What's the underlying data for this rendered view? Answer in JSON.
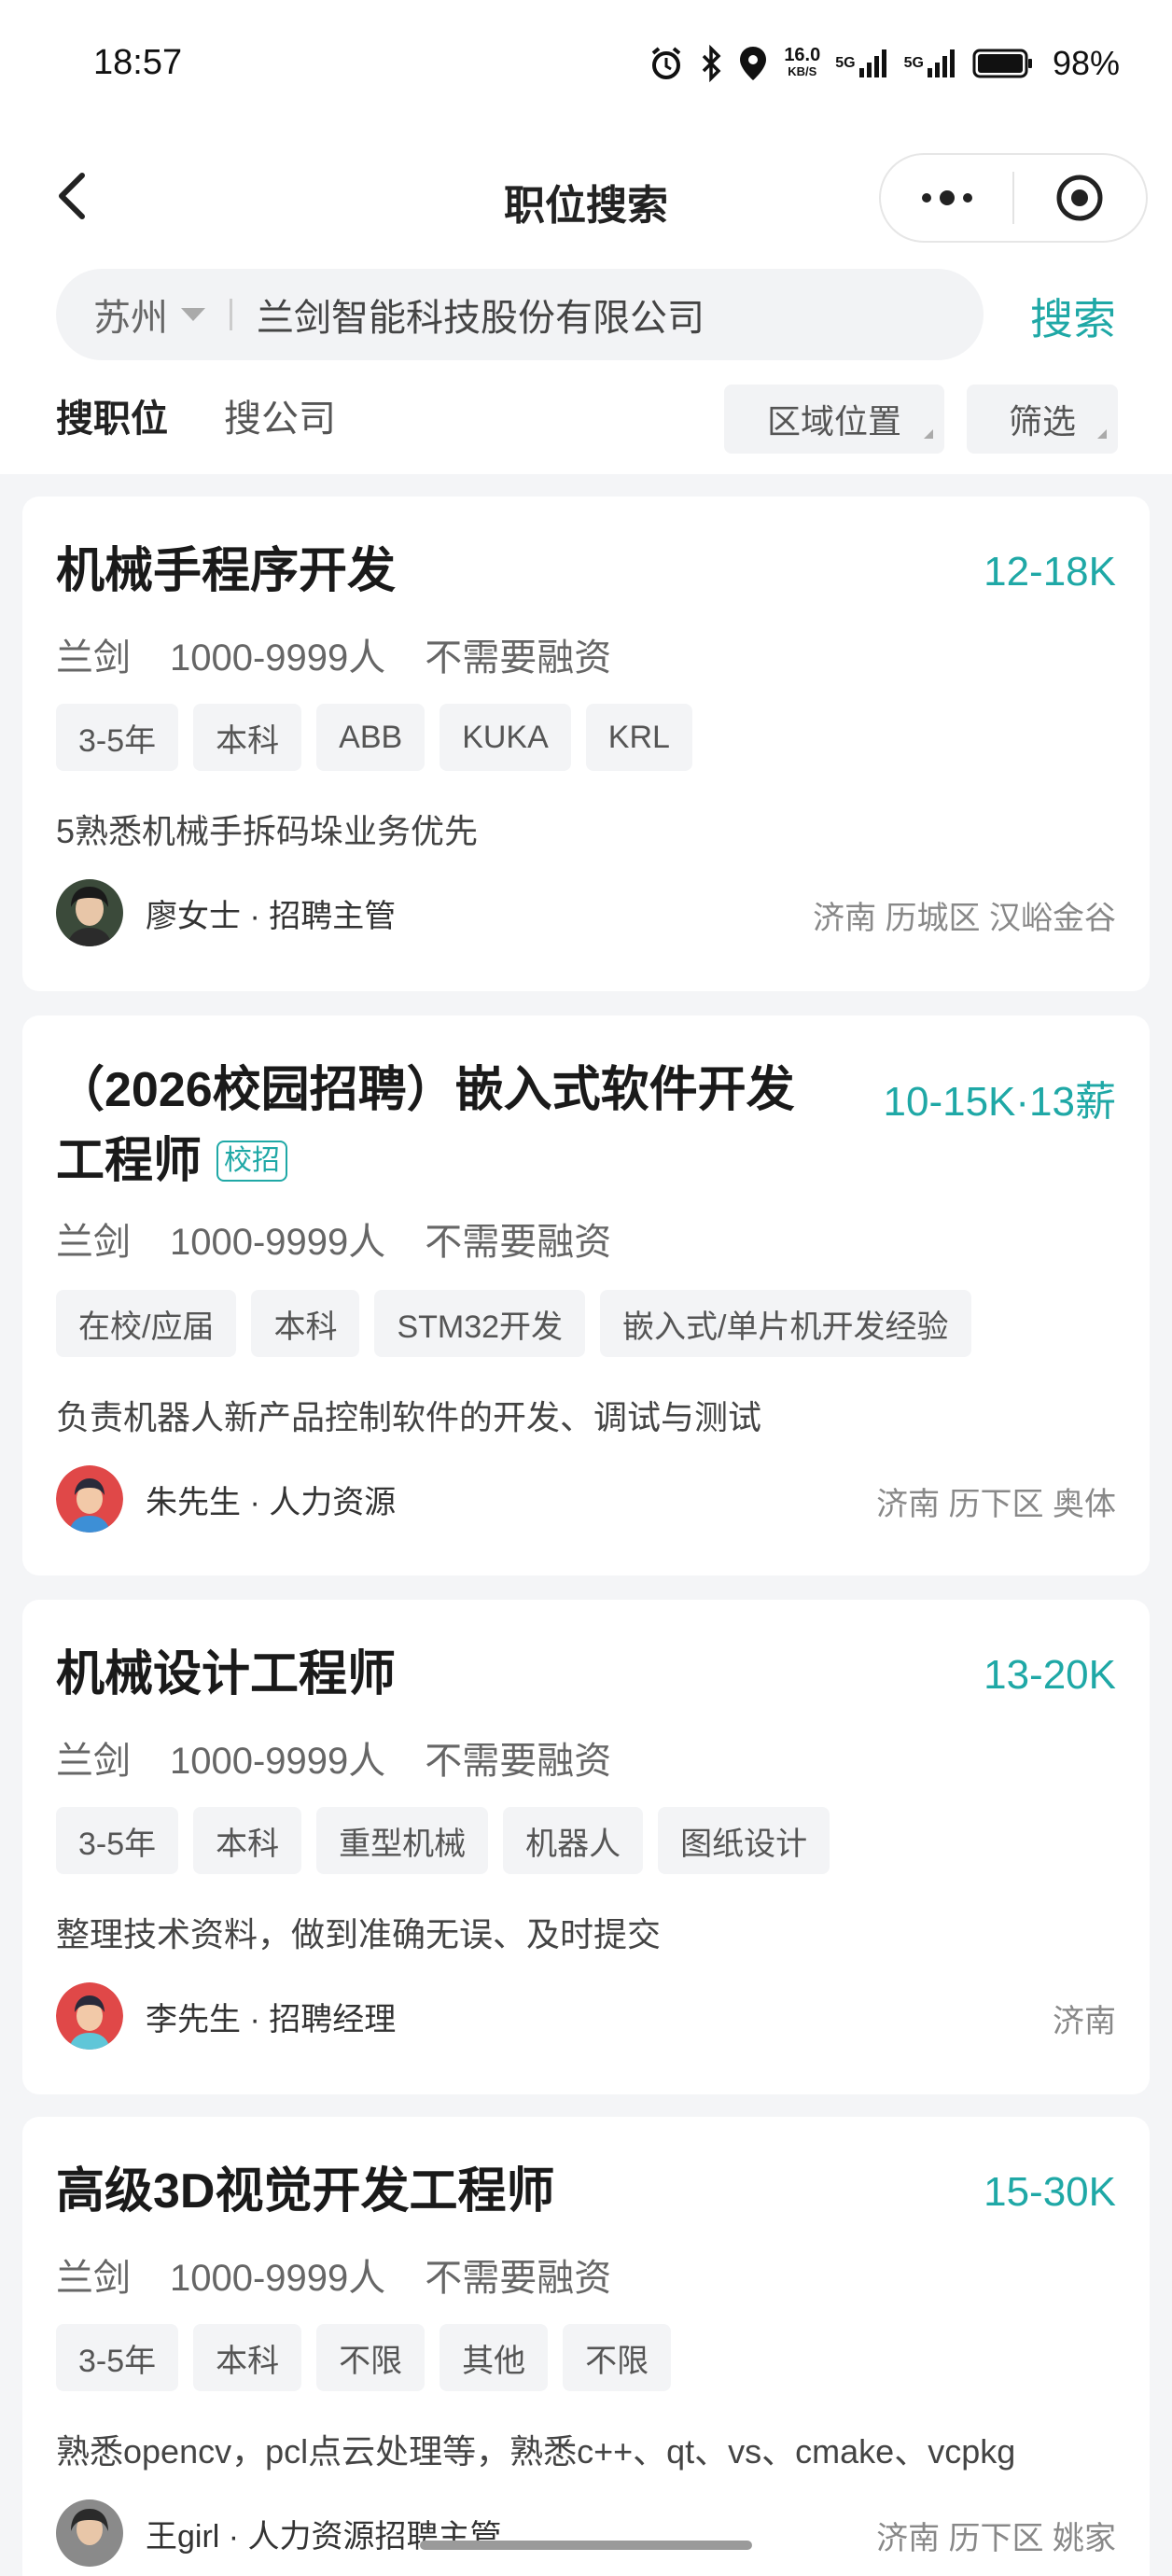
{
  "status_bar": {
    "time": "18:57",
    "net_speed": "16.0",
    "net_speed_unit": "KB/S",
    "signal_1_label": "5G",
    "signal_2_label": "5G",
    "battery": "98%",
    "icons": [
      "alarm-icon",
      "bluetooth-icon",
      "location-icon",
      "signal-icon",
      "battery-icon"
    ]
  },
  "nav": {
    "title": "职位搜索"
  },
  "search": {
    "city": "苏州",
    "query": "兰剑智能科技股份有限公司",
    "button_label": "搜索"
  },
  "tabs": {
    "jobs": "搜职位",
    "companies": "搜公司",
    "filter_area": "区域位置",
    "filter": "筛选"
  },
  "jobs": [
    {
      "title": "机械手程序开发",
      "salary": "12-18K",
      "company": "兰剑",
      "size": "1000-9999人",
      "funding": "不需要融资",
      "tags": [
        "3-5年",
        "本科",
        "ABB",
        "KUKA",
        "KRL"
      ],
      "desc": "5熟悉机械手拆码垛业务优先",
      "recruiter": "廖女士 · 招聘主管",
      "location": "济南 历城区 汉峪金谷"
    },
    {
      "title_line1": "（2026校园招聘）嵌入式软件开发",
      "title_line2": "工程师",
      "badge": "校招",
      "salary": "10-15K·13薪",
      "company": "兰剑",
      "size": "1000-9999人",
      "funding": "不需要融资",
      "tags": [
        "在校/应届",
        "本科",
        "STM32开发",
        "嵌入式/单片机开发经验"
      ],
      "desc": "负责机器人新产品控制软件的开发、调试与测试",
      "recruiter": "朱先生 · 人力资源",
      "location": "济南 历下区 奥体"
    },
    {
      "title": "机械设计工程师",
      "salary": "13-20K",
      "company": "兰剑",
      "size": "1000-9999人",
      "funding": "不需要融资",
      "tags": [
        "3-5年",
        "本科",
        "重型机械",
        "机器人",
        "图纸设计"
      ],
      "desc": "整理技术资料，做到准确无误、及时提交",
      "recruiter": "李先生 · 招聘经理",
      "location": "济南"
    },
    {
      "title": "高级3D视觉开发工程师",
      "salary": "15-30K",
      "company": "兰剑",
      "size": "1000-9999人",
      "funding": "不需要融资",
      "tags": [
        "3-5年",
        "本科",
        "不限",
        "其他",
        "不限"
      ],
      "desc": "熟悉opencv，pcl点云处理等，熟悉c++、qt、vs、cmake、vcpkg",
      "recruiter": "王girl · 人力资源招聘主管",
      "location": "济南 历下区 姚家"
    }
  ]
}
